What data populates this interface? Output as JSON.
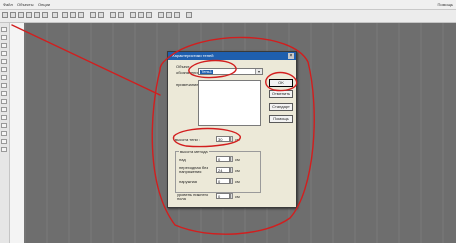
{
  "menu": {
    "items": [
      "Файл",
      "Объекты",
      "Опции"
    ],
    "help": "Помощь"
  },
  "dialog": {
    "title": "Характеристики теней",
    "object_label": "Объект",
    "name_label": "обозначение:",
    "name_value": "Тень1",
    "description_label": "примечание:",
    "height_label": "высота тени :",
    "height_value": "30",
    "height_unit": "см",
    "group_title": "высота метода",
    "fields": [
      {
        "label": "над",
        "value": "0",
        "unit": "см"
      },
      {
        "label": "переходная без напряжения",
        "value": "24",
        "unit": "см"
      },
      {
        "label": "наружная",
        "value": "0",
        "unit": "см"
      }
    ],
    "bottom_label": "уровень нижнего пола",
    "bottom_value": "0",
    "bottom_unit": "см",
    "buttons": {
      "ok": "OK",
      "cancel": "Отменить",
      "standard": "Стандарт",
      "help": "Помощь"
    }
  },
  "annotation_color": "#d21e1e"
}
